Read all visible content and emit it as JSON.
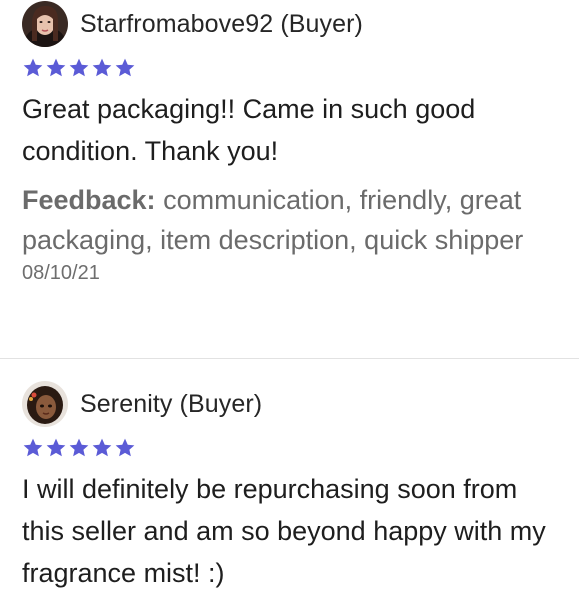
{
  "reviews": [
    {
      "reviewer": "Starfromabove92 (Buyer)",
      "rating": 5,
      "comment": "Great packaging!! Came in such good condition. Thank you!",
      "feedback_label": "Feedback:",
      "feedback_tags": "communication, friendly, great packaging, item description, quick shipper",
      "date": "08/10/21",
      "avatar_icon": "user-avatar-woman-photo"
    },
    {
      "reviewer": "Serenity (Buyer)",
      "rating": 5,
      "comment": "I will definitely be repurchasing soon from this seller and am so beyond happy with my fragrance mist! :)",
      "avatar_icon": "user-avatar-cartoon-photo"
    }
  ],
  "colors": {
    "star": "#5b5bd6",
    "divider": "#e2e2e2",
    "muted_text": "#6b6b6b"
  },
  "icons": {
    "star": "star-icon"
  }
}
